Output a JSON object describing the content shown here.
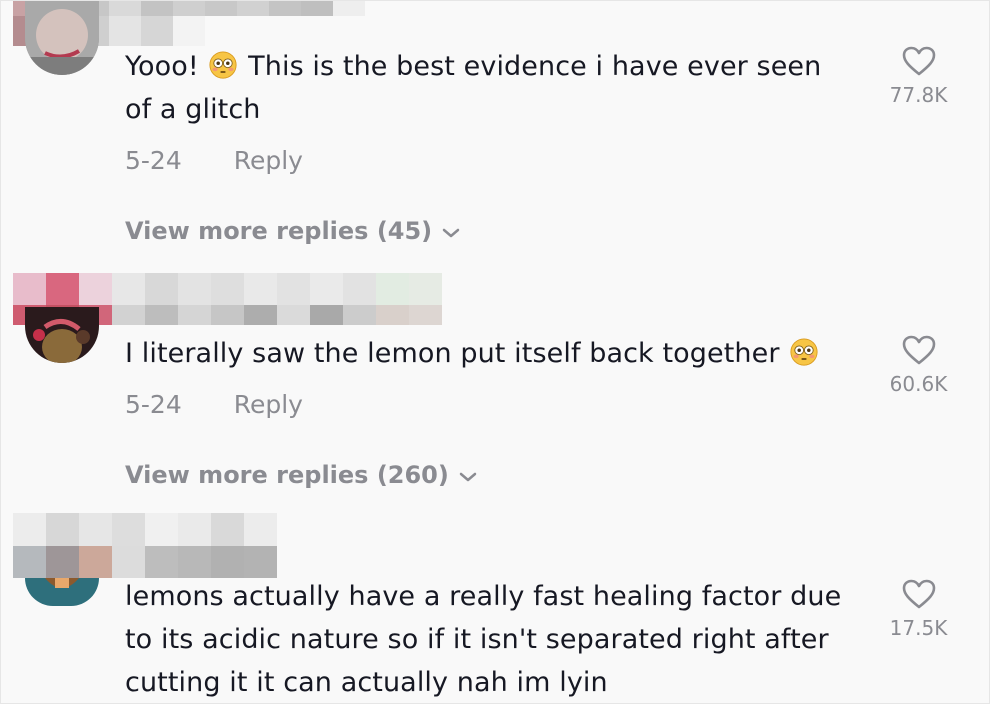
{
  "comments": [
    {
      "text_before_emoji": "Yooo!",
      "text_after_emoji": "This is the best evidence i have ever seen of a glitch",
      "emoji_icon": "flushed-face-emoji",
      "date": "5-24",
      "reply_label": "Reply",
      "likes": "77.8K",
      "view_more": "View more replies (45)"
    },
    {
      "text_before_emoji": "I literally saw the lemon put itself back together",
      "text_after_emoji": "",
      "emoji_icon": "flushed-face-emoji",
      "date": "5-24",
      "reply_label": "Reply",
      "likes": "60.6K",
      "view_more": "View more replies (260)"
    },
    {
      "text": "lemons actually have a really fast healing factor due to its acidic nature so if it isn't separated right after cutting it it can actually nah im lyin",
      "likes": "17.5K"
    }
  ],
  "colors": {
    "primary_text": "#161823",
    "secondary_text": "#8a8b91",
    "background": "#f9f9f9"
  }
}
